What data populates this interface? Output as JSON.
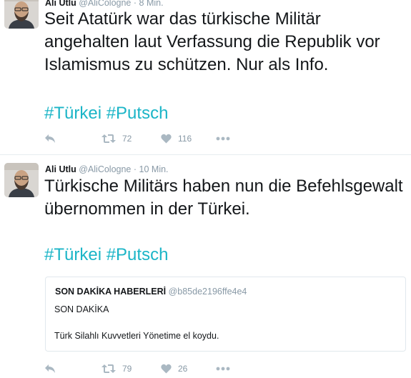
{
  "tweets": [
    {
      "author": {
        "name": "Ali Utlu",
        "handle": "@AliCologne"
      },
      "separator": "·",
      "time": "8 Min.",
      "text": "Seit Atatürk war das türkische Militär angehalten laut Verfassung die Republik vor Islamismus zu schützen. Nur als Info.",
      "hashtags": [
        "#Türkei",
        "#Putsch"
      ],
      "actions": {
        "reply_icon": "reply-icon",
        "retweets": "72",
        "likes": "116",
        "more_icon": "more-icon"
      }
    },
    {
      "author": {
        "name": "Ali Utlu",
        "handle": "@AliCologne"
      },
      "separator": "·",
      "time": "10 Min.",
      "text": "Türkische Militärs haben nun die Befehlsgewalt übernommen in der Türkei.",
      "hashtags": [
        "#Türkei",
        "#Putsch"
      ],
      "quote": {
        "name": "SON DAKİKA HABERLERİ",
        "handle": "@b85de2196ffe4e4",
        "line1": "SON DAKİKA",
        "line2": "Türk Silahlı Kuvvetleri Yönetime el koydu."
      },
      "actions": {
        "reply_icon": "reply-icon",
        "retweets": "79",
        "likes": "26",
        "more_icon": "more-icon"
      }
    }
  ],
  "colors": {
    "hashtag": "#1bb5c7",
    "meta": "#8899a6",
    "icon": "#aab8c2",
    "border": "#e1e8ed"
  }
}
